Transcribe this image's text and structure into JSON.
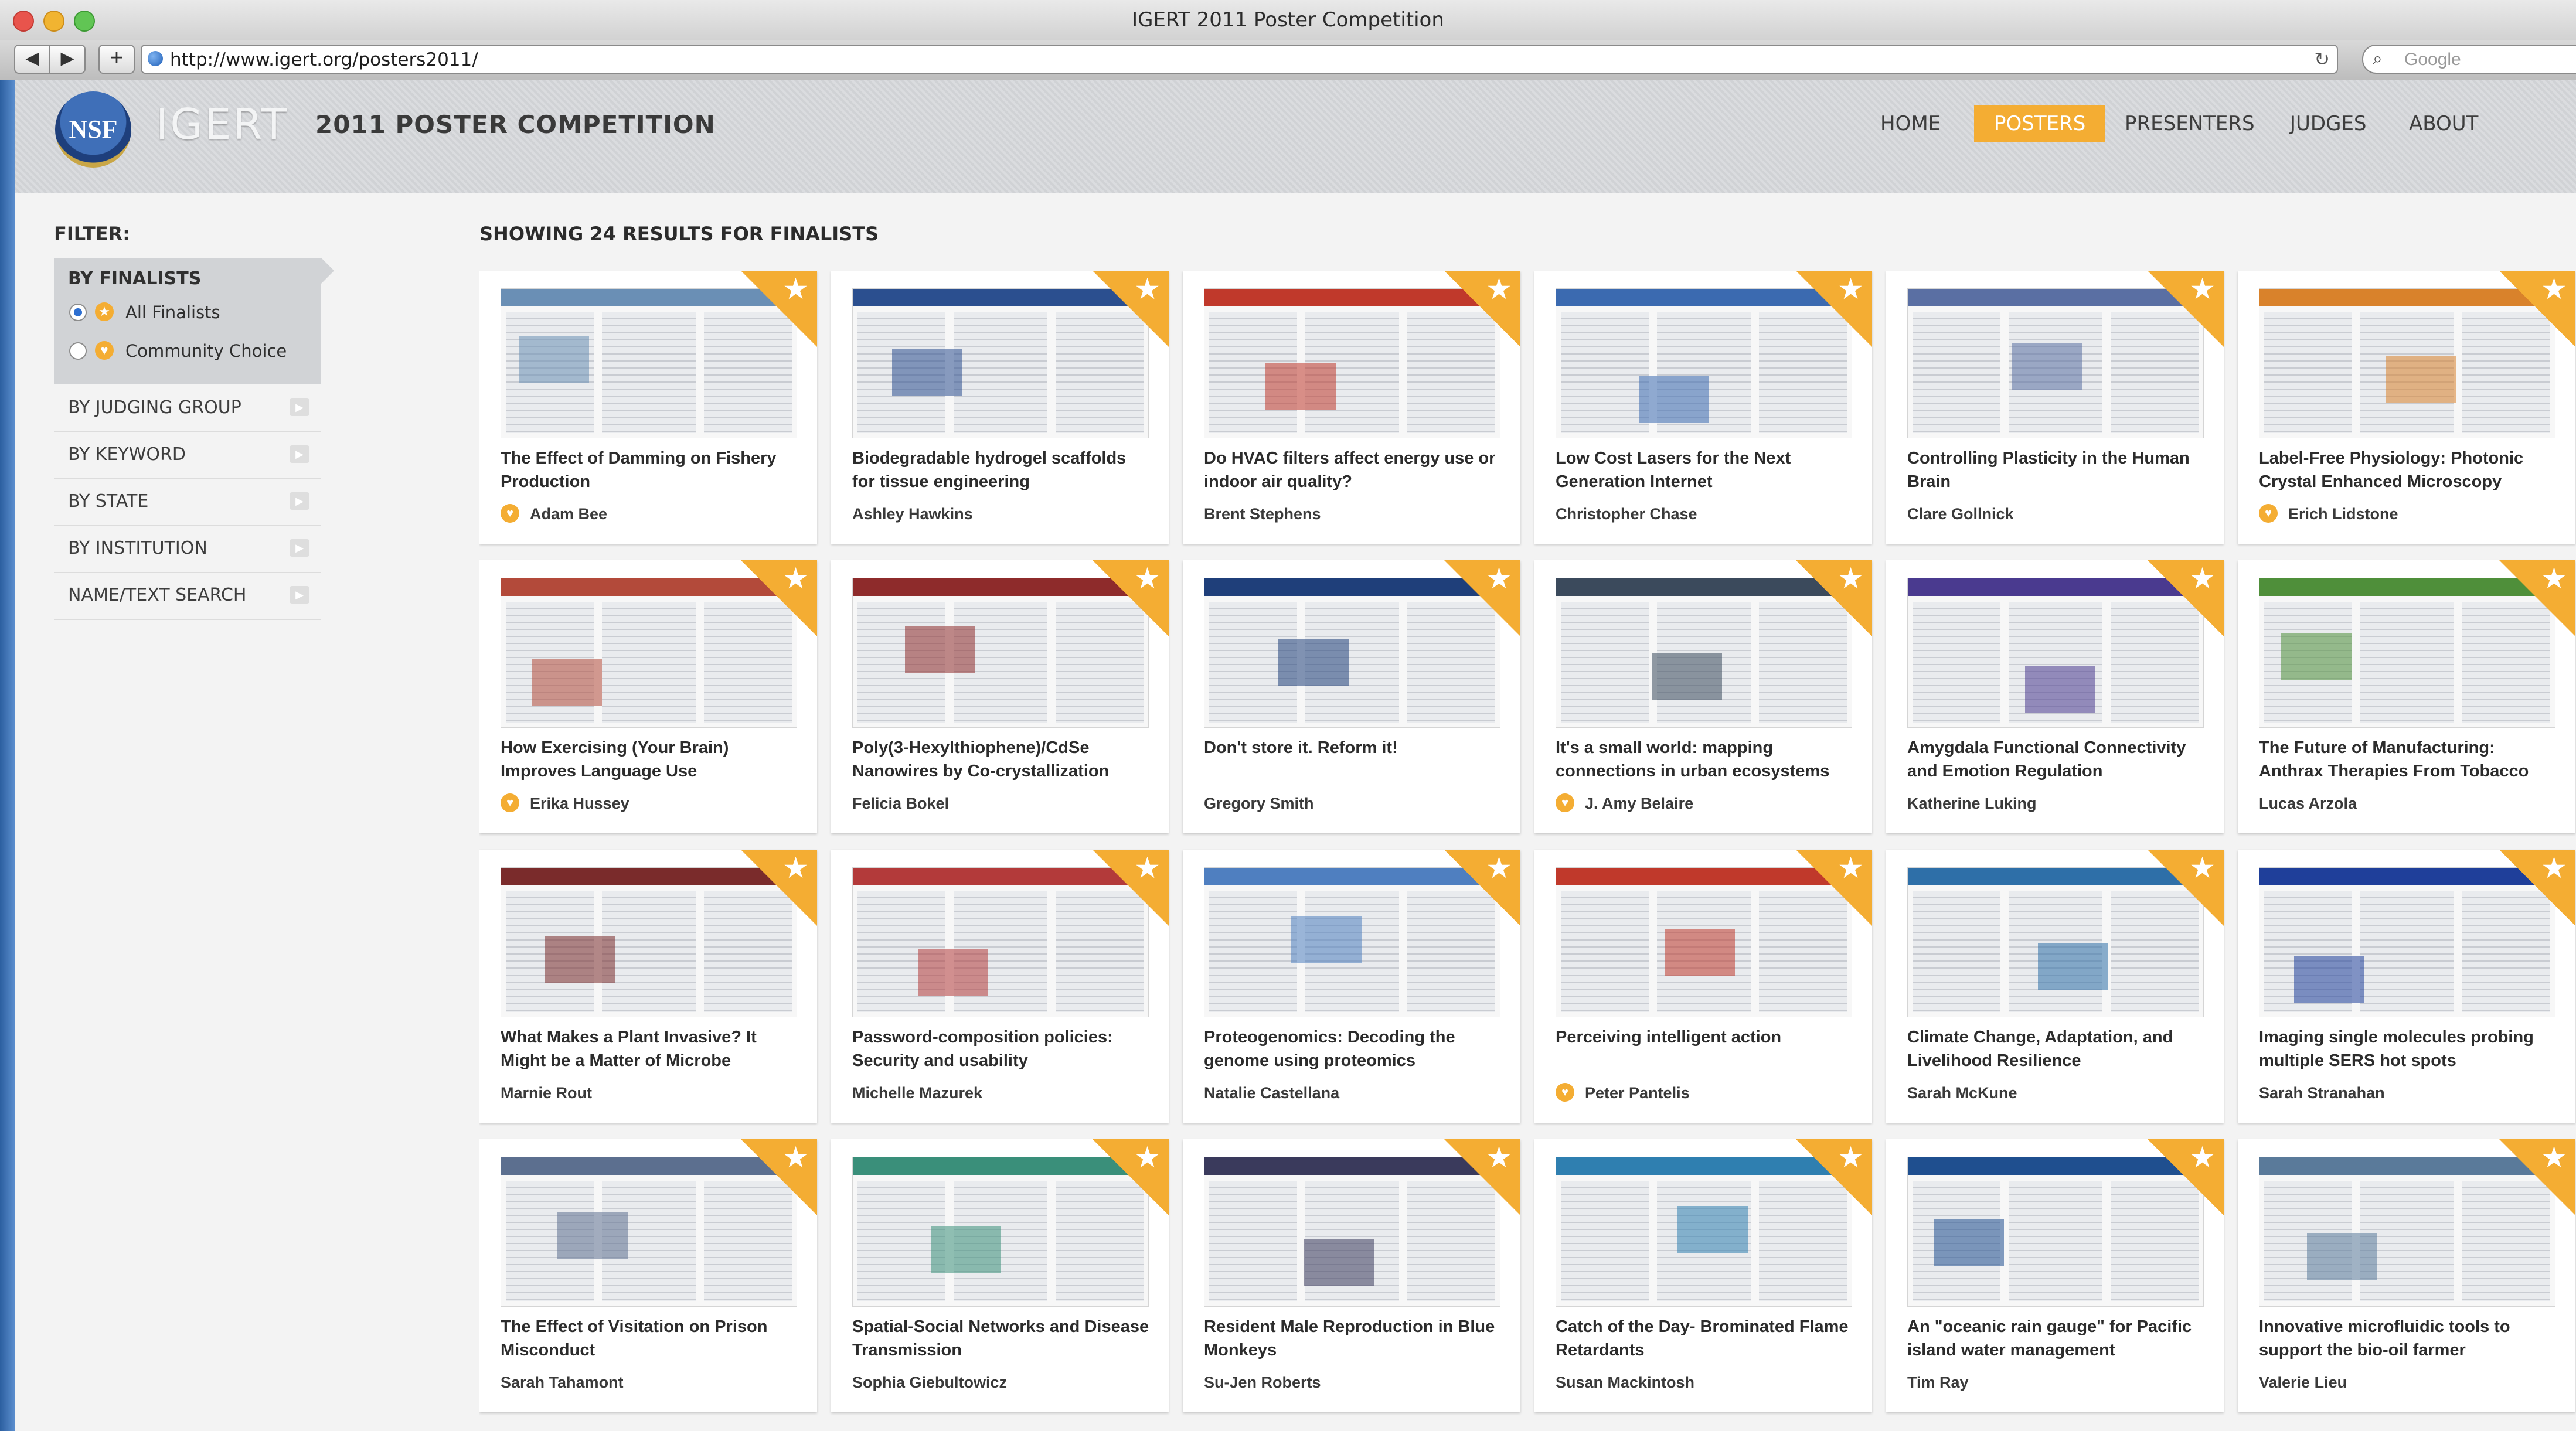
{
  "browser": {
    "window_title": "IGERT 2011 Poster Competition",
    "back_glyph": "◀",
    "forward_glyph": "▶",
    "add_glyph": "+",
    "url": "http://www.igert.org/posters2011/",
    "reload_glyph": "↻",
    "search_placeholder": "Google",
    "search_glyph": "⌕"
  },
  "header": {
    "logo_text": "NSF",
    "brand": "IGERT",
    "title": "2011 POSTER COMPETITION",
    "nav": [
      {
        "label": "HOME"
      },
      {
        "label": "POSTERS"
      },
      {
        "label": "PRESENTERS"
      },
      {
        "label": "JUDGES"
      },
      {
        "label": "ABOUT"
      }
    ],
    "active_nav": "POSTERS",
    "accent_color": "#f4ad33"
  },
  "sidebar": {
    "filter_label": "FILTER:",
    "active_group": "BY FINALISTS",
    "options": [
      {
        "label": "All Finalists",
        "selected": true
      },
      {
        "label": "Community Choice",
        "selected": false
      }
    ],
    "groups": [
      {
        "label": "BY JUDGING GROUP"
      },
      {
        "label": "BY KEYWORD"
      },
      {
        "label": "BY STATE"
      },
      {
        "label": "BY INSTITUTION"
      },
      {
        "label": "NAME/TEXT SEARCH"
      }
    ],
    "arrow_glyph": "▶"
  },
  "results": {
    "heading": "SHOWING 24 RESULTS FOR FINALISTS",
    "star_glyph": "★",
    "posters": [
      {
        "title": "The Effect of Damming on Fishery Production",
        "author": "Adam Bee",
        "community_choice": true,
        "accent": "#6a8fb5"
      },
      {
        "title": "Biodegradable hydrogel scaffolds for tissue engineering",
        "author": "Ashley Hawkins",
        "community_choice": false,
        "accent": "#2b4f8f"
      },
      {
        "title": "Do HVAC filters affect energy use or indoor air quality?",
        "author": "Brent Stephens",
        "community_choice": false,
        "accent": "#c0392b"
      },
      {
        "title": "Low Cost Lasers for the Next Generation Internet",
        "author": "Christopher Chase",
        "community_choice": false,
        "accent": "#3b6ab0"
      },
      {
        "title": "Controlling Plasticity in the Human Brain",
        "author": "Clare Gollnick",
        "community_choice": false,
        "accent": "#5a6fa3"
      },
      {
        "title": "Label-Free Physiology: Photonic Crystal Enhanced Microscopy",
        "author": "Erich Lidstone",
        "community_choice": true,
        "accent": "#d9822b"
      },
      {
        "title": "How Exercising (Your Brain) Improves Language Use",
        "author": "Erika Hussey",
        "community_choice": true,
        "accent": "#b34a3a"
      },
      {
        "title": "Poly(3-Hexylthiophene)/CdSe Nanowires by Co-crystallization",
        "author": "Felicia Bokel",
        "community_choice": false,
        "accent": "#8e2b2b"
      },
      {
        "title": "Don't store it. Reform it!",
        "author": "Gregory Smith",
        "community_choice": false,
        "accent": "#1f3f7a"
      },
      {
        "title": "It's a small world: mapping connections in urban ecosystems",
        "author": "J. Amy Belaire",
        "community_choice": true,
        "accent": "#3b4a5c"
      },
      {
        "title": "Amygdala Functional Connectivity and Emotion Regulation",
        "author": "Katherine Luking",
        "community_choice": false,
        "accent": "#4a3a8f"
      },
      {
        "title": "The Future of Manufacturing: Anthrax Therapies From Tobacco",
        "author": "Lucas Arzola",
        "community_choice": false,
        "accent": "#4f8f3a"
      },
      {
        "title": "What Makes a Plant Invasive? It Might be a Matter of Microbe",
        "author": "Marnie Rout",
        "community_choice": false,
        "accent": "#7a2b2b"
      },
      {
        "title": "Password-composition policies: Security and usability",
        "author": "Michelle Mazurek",
        "community_choice": false,
        "accent": "#b33a3a"
      },
      {
        "title": "Proteogenomics: Decoding the genome using proteomics",
        "author": "Natalie Castellana",
        "community_choice": false,
        "accent": "#4f7fc0"
      },
      {
        "title": "Perceiving intelligent action",
        "author": "Peter Pantelis",
        "community_choice": true,
        "accent": "#c0392b"
      },
      {
        "title": "Climate Change, Adaptation, and Livelihood Resilience",
        "author": "Sarah McKune",
        "community_choice": false,
        "accent": "#2e6fa8"
      },
      {
        "title": "Imaging single molecules probing multiple SERS hot spots",
        "author": "Sarah Stranahan",
        "community_choice": false,
        "accent": "#1f3f9a"
      },
      {
        "title": "The Effect of Visitation on Prison Misconduct",
        "author": "Sarah Tahamont",
        "community_choice": false,
        "accent": "#5c6f8f"
      },
      {
        "title": "Spatial-Social Networks and Disease Transmission",
        "author": "Sophia Giebultowicz",
        "community_choice": false,
        "accent": "#3a8f7a"
      },
      {
        "title": "Resident Male Reproduction in Blue Monkeys",
        "author": "Su-Jen Roberts",
        "community_choice": false,
        "accent": "#3a3a5c"
      },
      {
        "title": "Catch of the Day- Brominated Flame Retardants",
        "author": "Susan Mackintosh",
        "community_choice": false,
        "accent": "#2f7fb0"
      },
      {
        "title": "An \"oceanic rain gauge\" for Pacific island water management",
        "author": "Tim Ray",
        "community_choice": false,
        "accent": "#1f4f8f"
      },
      {
        "title": "Innovative microfluidic tools to support the bio-oil farmer",
        "author": "Valerie Lieu",
        "community_choice": false,
        "accent": "#5a7a9a"
      }
    ]
  }
}
